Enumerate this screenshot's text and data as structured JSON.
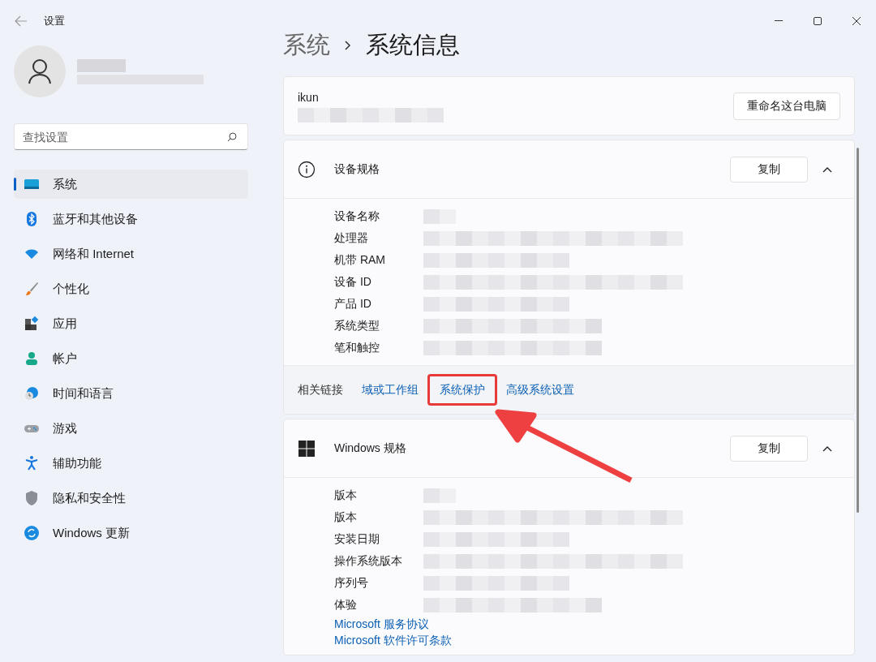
{
  "window": {
    "title": "设置"
  },
  "search": {
    "placeholder": "查找设置"
  },
  "sidebar": {
    "items": [
      {
        "label": "系统",
        "selected": true
      },
      {
        "label": "蓝牙和其他设备",
        "selected": false
      },
      {
        "label": "网络和 Internet",
        "selected": false
      },
      {
        "label": "个性化",
        "selected": false
      },
      {
        "label": "应用",
        "selected": false
      },
      {
        "label": "帐户",
        "selected": false
      },
      {
        "label": "时间和语言",
        "selected": false
      },
      {
        "label": "游戏",
        "selected": false
      },
      {
        "label": "辅助功能",
        "selected": false
      },
      {
        "label": "隐私和安全性",
        "selected": false
      },
      {
        "label": "Windows 更新",
        "selected": false
      }
    ]
  },
  "breadcrumb": [
    "系统",
    "系统信息"
  ],
  "pc": {
    "name": "ikun",
    "rename_button": "重命名这台电脑"
  },
  "sections": [
    {
      "title": "设备规格",
      "copy_button": "复制",
      "expanded": true,
      "rows": [
        "设备名称",
        "处理器",
        "机带 RAM",
        "设备 ID",
        "产品 ID",
        "系统类型",
        "笔和触控"
      ],
      "related": {
        "label": "相关链接",
        "links": [
          {
            "label": "域或工作组",
            "highlighted": false
          },
          {
            "label": "系统保护",
            "highlighted": true
          },
          {
            "label": "高级系统设置",
            "highlighted": false
          }
        ]
      }
    },
    {
      "title": "Windows 规格",
      "copy_button": "复制",
      "expanded": true,
      "rows": [
        "版本",
        "版本",
        "安装日期",
        "操作系统版本",
        "序列号",
        "体验"
      ],
      "links": [
        "Microsoft 服务协议",
        "Microsoft 软件许可条款"
      ]
    }
  ]
}
